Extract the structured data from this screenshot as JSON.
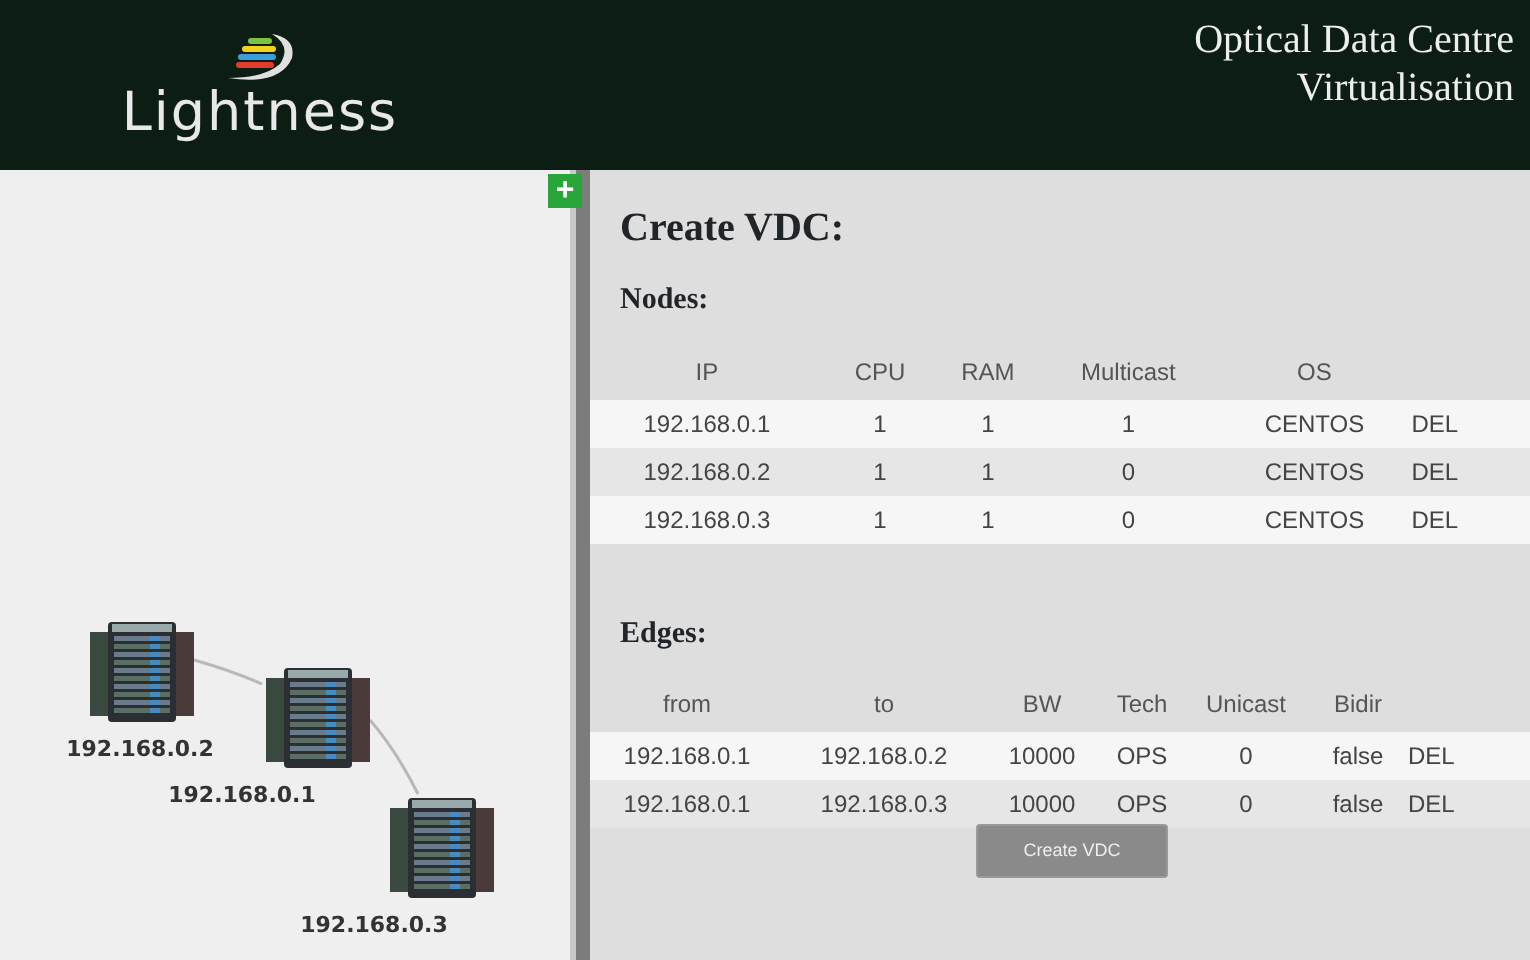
{
  "header": {
    "brand": "Lightness",
    "title_lines": [
      "Optical Data Centre",
      "Virtualisation"
    ]
  },
  "add_button": "+",
  "graph": {
    "nodes": [
      {
        "label": "192.168.0.2"
      },
      {
        "label": "192.168.0.1"
      },
      {
        "label": "192.168.0.3"
      }
    ]
  },
  "form": {
    "title": "Create VDC:",
    "nodes": {
      "heading": "Nodes:",
      "columns": [
        "IP",
        "CPU",
        "RAM",
        "Multicast",
        "OS"
      ],
      "rows": [
        {
          "cells": [
            "192.168.0.1",
            "1",
            "1",
            "1",
            "CENTOS"
          ],
          "action": "DEL"
        },
        {
          "cells": [
            "192.168.0.2",
            "1",
            "1",
            "0",
            "CENTOS"
          ],
          "action": "DEL"
        },
        {
          "cells": [
            "192.168.0.3",
            "1",
            "1",
            "0",
            "CENTOS"
          ],
          "action": "DEL"
        }
      ]
    },
    "edges": {
      "heading": "Edges:",
      "columns": [
        "from",
        "to",
        "BW",
        "Tech",
        "Unicast",
        "Bidir"
      ],
      "rows": [
        {
          "cells": [
            "192.168.0.1",
            "192.168.0.2",
            "10000",
            "OPS",
            "0",
            "false"
          ],
          "action": "DEL"
        },
        {
          "cells": [
            "192.168.0.1",
            "192.168.0.3",
            "10000",
            "OPS",
            "0",
            "false"
          ],
          "action": "DEL"
        }
      ]
    },
    "submit": "Create VDC"
  }
}
